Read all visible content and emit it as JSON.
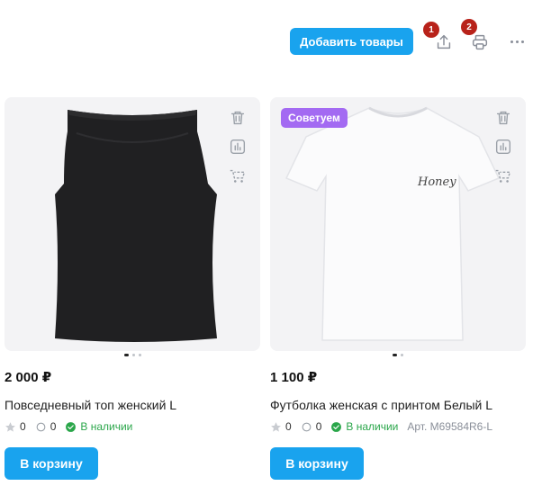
{
  "toolbar": {
    "add_products_label": "Добавить товары",
    "share_badge": "1",
    "print_badge": "2",
    "icons": {
      "share": "upload-icon",
      "print": "printer-icon",
      "more": "more-horizontal-icon"
    }
  },
  "colors": {
    "accent": "#19a3ee",
    "badge": "#b8221a",
    "promo": "#a36af2",
    "in_stock": "#2aa64a"
  },
  "products": [
    {
      "price": "2 000 ₽",
      "title": "Повседневный топ женский L",
      "rating": "0",
      "reviews": "0",
      "stock": "В наличии",
      "article": "",
      "promo": "",
      "cart_label": "В корзину",
      "image": "black-sleeveless-top",
      "image_slides": 3,
      "active_slide": 1
    },
    {
      "price": "1 100 ₽",
      "title": "Футболка женская с принтом Белый L",
      "rating": "0",
      "reviews": "0",
      "stock": "В наличии",
      "article": "Арт. M69584R6-L",
      "promo": "Советуем",
      "print_text": "Honey",
      "cart_label": "В корзину",
      "image": "white-tshirt-honey-print",
      "image_slides": 2,
      "active_slide": 1
    }
  ]
}
